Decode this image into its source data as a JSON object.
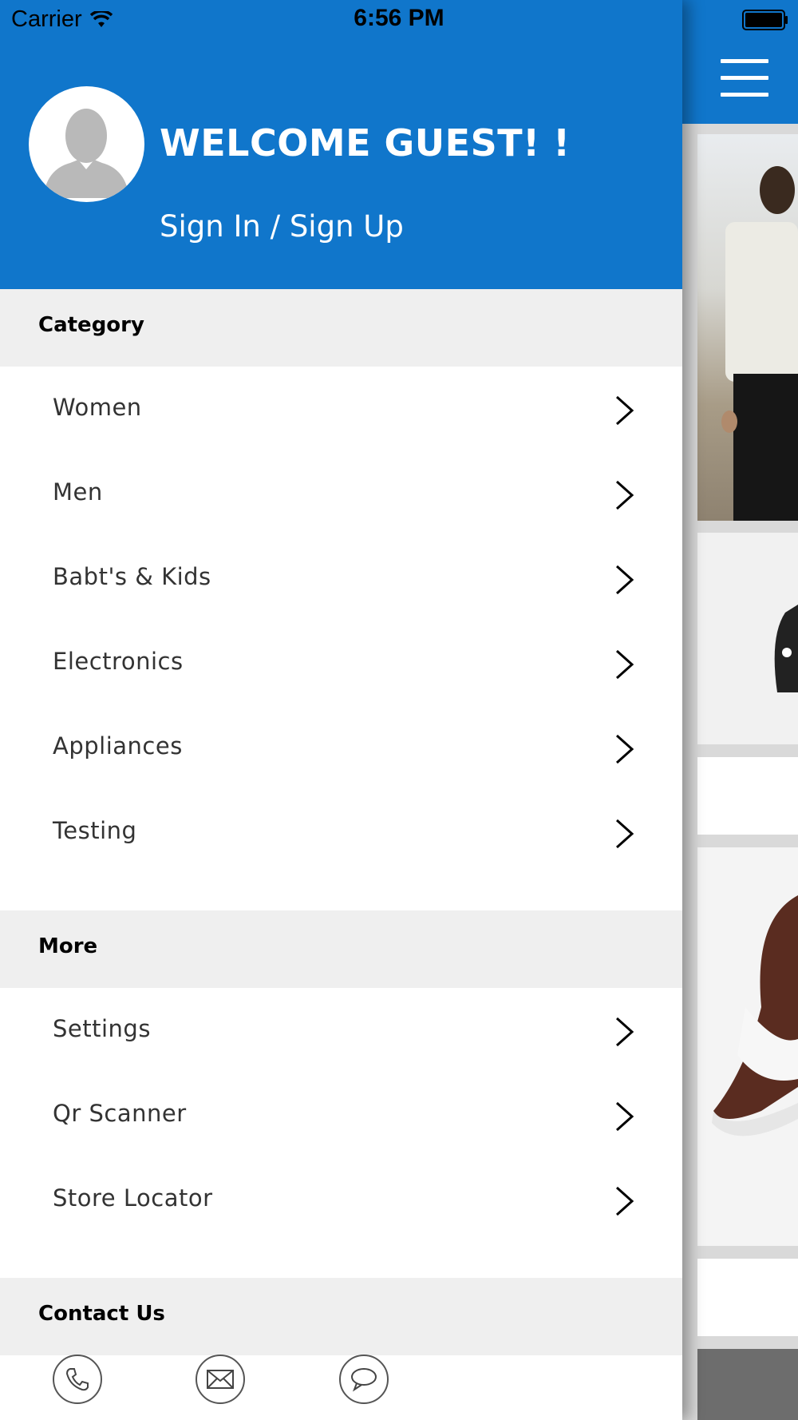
{
  "status_bar": {
    "carrier": "Carrier",
    "time": "6:56 PM"
  },
  "drawer": {
    "welcome": "WELCOME GUEST! !",
    "sign_in": "Sign In / Sign Up",
    "sections": {
      "category": {
        "title": "Category",
        "items": [
          "Women",
          "Men",
          "Babt's & Kids",
          "Electronics",
          "Appliances",
          "Testing"
        ]
      },
      "more": {
        "title": "More",
        "items": [
          "Settings",
          "Qr Scanner",
          "Store Locator"
        ]
      },
      "contact": {
        "title": "Contact Us",
        "icons": [
          "phone-icon",
          "mail-icon",
          "chat-icon"
        ]
      }
    }
  },
  "colors": {
    "primary": "#1076cb",
    "section_bg": "#efefef"
  }
}
